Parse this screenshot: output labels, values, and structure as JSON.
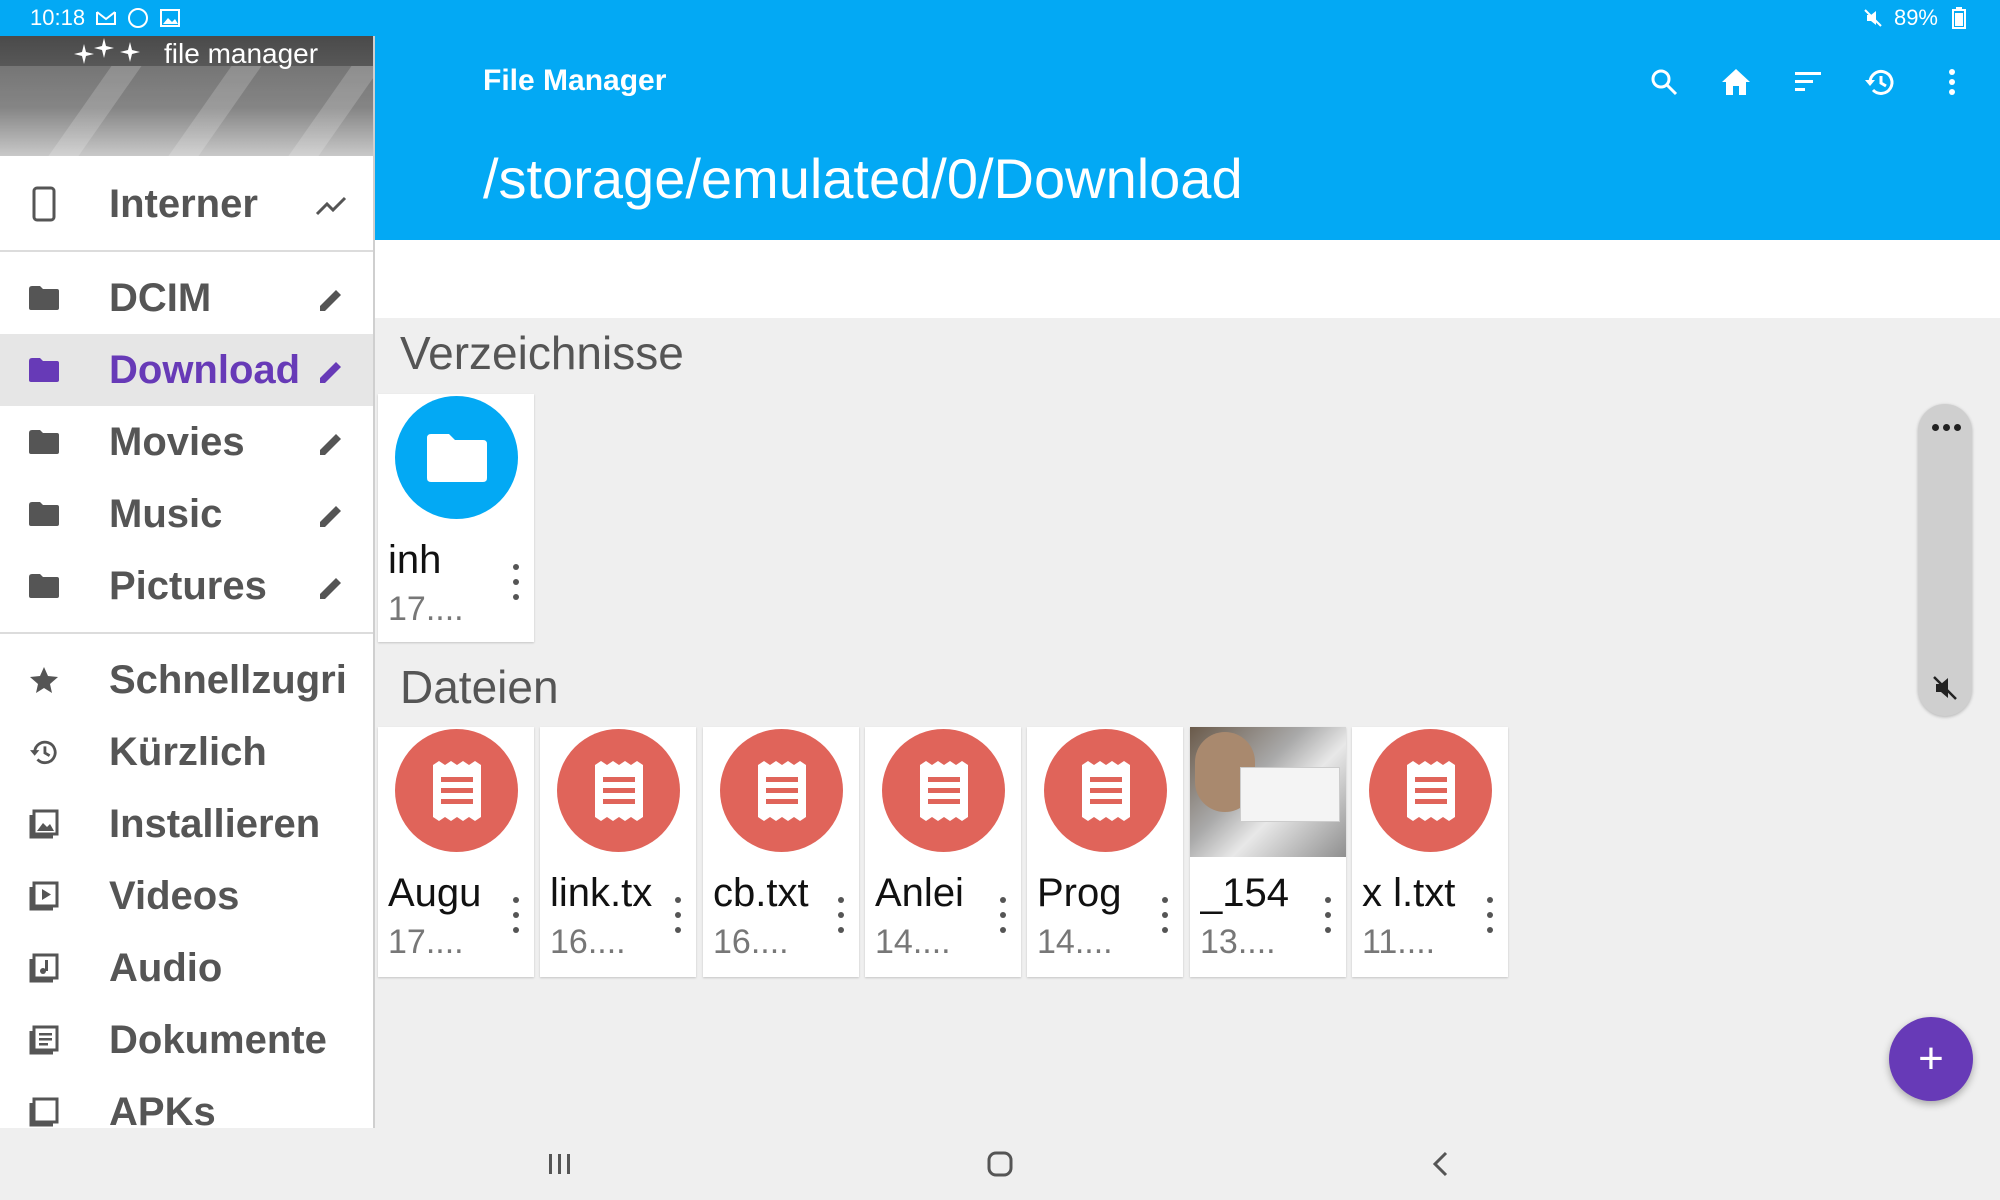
{
  "status_bar": {
    "time": "10:18",
    "battery": "89%",
    "notification_badge": "89"
  },
  "app_bar": {
    "title": "File Manager",
    "path": "/storage/emulated/0/Download",
    "actions": [
      "search-icon",
      "home-icon",
      "sort-icon",
      "history-icon",
      "more-vert-icon"
    ]
  },
  "drawer": {
    "brand": "file manager",
    "storage": {
      "label": "Interner",
      "icon": "phone-icon",
      "trail_icon": "chart-icon"
    },
    "folders": [
      {
        "label": "DCIM",
        "active": false
      },
      {
        "label": "Download",
        "active": true
      },
      {
        "label": "Movies",
        "active": false
      },
      {
        "label": "Music",
        "active": false
      },
      {
        "label": "Pictures",
        "active": false
      }
    ],
    "categories": [
      {
        "label": "Schnellzugri",
        "icon": "star-icon"
      },
      {
        "label": "Kürzlich",
        "icon": "history-icon"
      },
      {
        "label": "Installieren",
        "icon": "image-icon"
      },
      {
        "label": "Videos",
        "icon": "video-icon"
      },
      {
        "label": "Audio",
        "icon": "audio-icon"
      },
      {
        "label": "Dokumente",
        "icon": "document-icon"
      },
      {
        "label": "APKs",
        "icon": "apk-icon"
      }
    ]
  },
  "main": {
    "directories_title": "Verzeichnisse",
    "directories": [
      {
        "name": "inh",
        "date": "17...."
      }
    ],
    "files_title": "Dateien",
    "files": [
      {
        "name": "Augu",
        "date": "17....",
        "type": "text"
      },
      {
        "name": "link.tx",
        "date": "16....",
        "type": "text"
      },
      {
        "name": "cb.txt",
        "date": "16....",
        "type": "text"
      },
      {
        "name": "Anlei",
        "date": "14....",
        "type": "text"
      },
      {
        "name": "Prog",
        "date": "14....",
        "type": "text"
      },
      {
        "name": "_154",
        "date": "13....",
        "type": "image"
      },
      {
        "name": "x l.txt",
        "date": "11....",
        "type": "text"
      }
    ]
  },
  "fab": {
    "label": "+"
  },
  "colors": {
    "primary": "#03a9f4",
    "accent": "#673ab7",
    "file_icon": "#e0645a",
    "folder_icon": "#03a9f4"
  }
}
